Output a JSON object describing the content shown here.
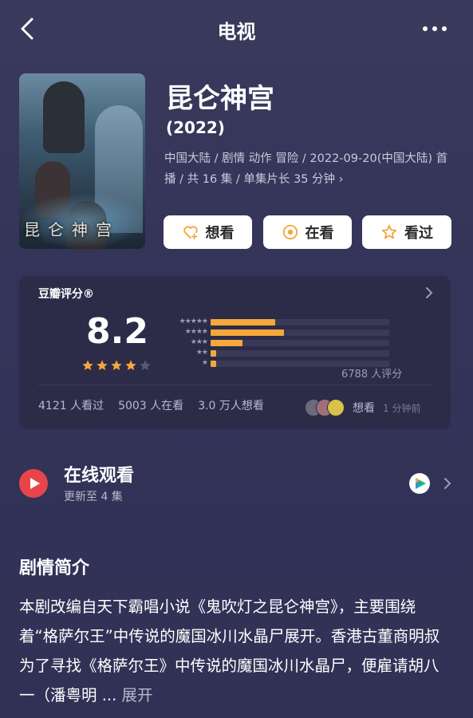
{
  "header": {
    "title": "电视"
  },
  "show": {
    "title": "昆仑神宫",
    "year": "(2022)",
    "meta": "中国大陆 / 剧情 动作 冒险 / 2022-09-20(中国大陆) 首播 / 共 16 集 / 单集片长 35 分钟",
    "meta_chevron": "›",
    "poster_text": "昆仑神宫"
  },
  "actions": {
    "want": "想看",
    "watching": "在看",
    "watched": "看过"
  },
  "rating": {
    "label": "豆瓣评分®",
    "score": "8.2",
    "star_value": 4,
    "distribution": [
      {
        "stars": "★★★★★",
        "fraction": 0.36
      },
      {
        "stars": "★★★★",
        "fraction": 0.41
      },
      {
        "stars": "★★★",
        "fraction": 0.18
      },
      {
        "stars": "★★",
        "fraction": 0.03
      },
      {
        "stars": "★",
        "fraction": 0.03
      }
    ],
    "count": "6788 人评分",
    "stats": [
      "4121 人看过",
      "5003 人在看",
      "3.0 万人想看"
    ],
    "recent_action": "想看",
    "recent_time": "1 分钟前"
  },
  "online": {
    "title": "在线观看",
    "subtitle": "更新至 4 集"
  },
  "synopsis": {
    "title": "剧情简介",
    "text": "本剧改编自天下霸唱小说《鬼吹灯之昆仑神宫》，主要围绕着“格萨尔王”中传说的魔国冰川水晶尸展开。香港古董商明叔为了寻找《格萨尔王》中传说的魔国冰川水晶尸，便雇请胡八一（潘粤明 ...",
    "expand": "展开"
  },
  "colors": {
    "accent": "#f4a73a",
    "background": "#34345a",
    "card": "#2c2c49",
    "play_red": "#e8454a"
  }
}
